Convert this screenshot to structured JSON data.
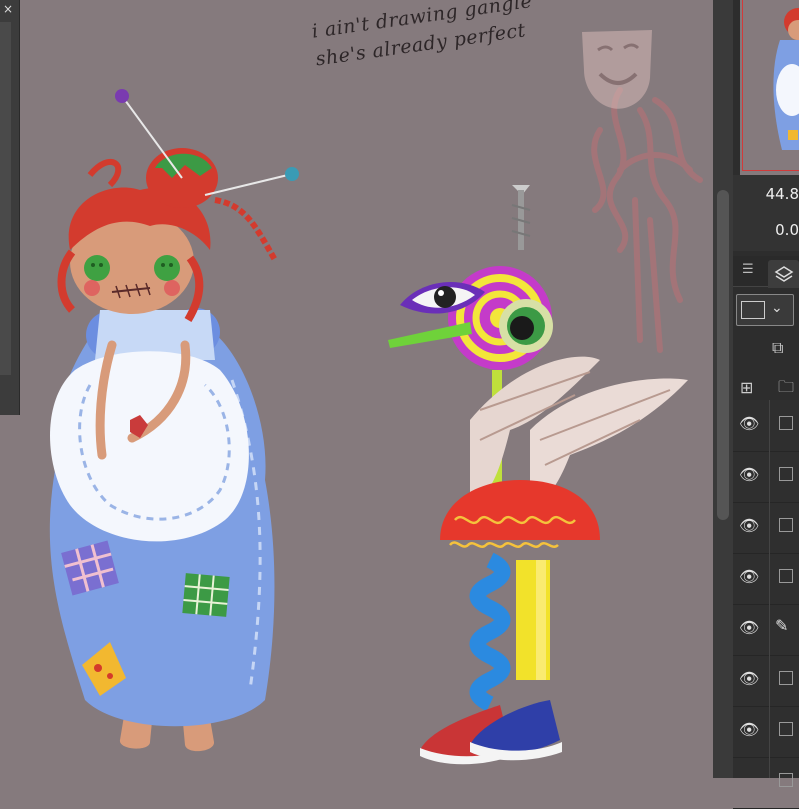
{
  "canvas": {
    "note_lines": [
      "i ain't drawing gangle",
      "she's already perfect"
    ]
  },
  "left_panel": {
    "close_glyph": "×"
  },
  "right_panel": {
    "readout_1": "44.8",
    "readout_2": "0.0",
    "panel_menu_icon": "menu-icon",
    "layers_tab_icon": "layers-icon",
    "layers": [
      {
        "visible": true,
        "locked": false,
        "editing": false
      },
      {
        "visible": true,
        "locked": false,
        "editing": false
      },
      {
        "visible": true,
        "locked": false,
        "editing": false
      },
      {
        "visible": true,
        "locked": false,
        "editing": false
      },
      {
        "visible": true,
        "locked": false,
        "editing": true
      },
      {
        "visible": true,
        "locked": false,
        "editing": false
      },
      {
        "visible": true,
        "locked": false,
        "editing": false
      },
      {
        "visible": false,
        "locked": false,
        "editing": false
      }
    ]
  },
  "colors": {
    "canvas_bg": "#857a7d",
    "panel_bg": "#2d2d2d",
    "nav_frame": "#d23a3a"
  }
}
